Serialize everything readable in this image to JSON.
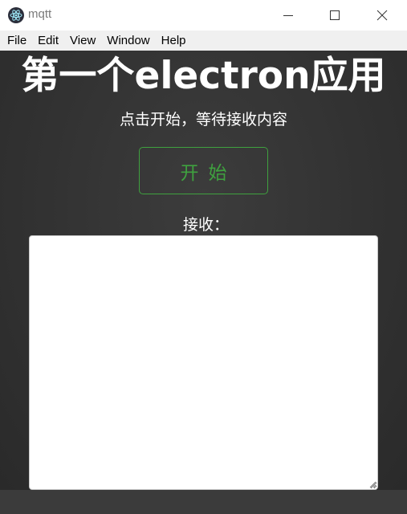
{
  "window": {
    "title": "mqtt",
    "app_icon": "electron-atom-icon",
    "controls": [
      "minimize-icon",
      "maximize-icon",
      "close-icon"
    ]
  },
  "menubar": {
    "items": [
      {
        "label": "File"
      },
      {
        "label": "Edit"
      },
      {
        "label": "View"
      },
      {
        "label": "Window"
      },
      {
        "label": "Help"
      }
    ]
  },
  "main": {
    "title_cn_prefix": "第一个",
    "title_en": "electron",
    "title_cn_suffix": "应用",
    "subtitle": "点击开始，等待接收内容",
    "start_button_label": "开始",
    "receive_label": "接收：",
    "receive_value": ""
  },
  "colors": {
    "background": "#333333",
    "accent_green": "#3fa13f",
    "text": "#ffffff"
  }
}
